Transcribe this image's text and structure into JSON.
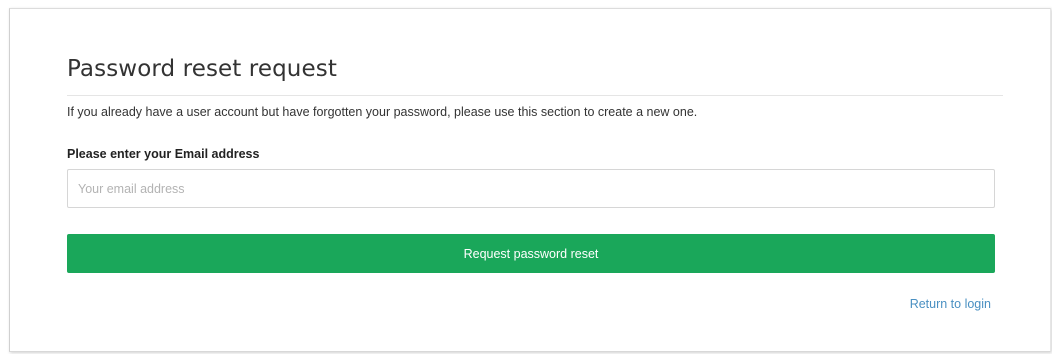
{
  "form": {
    "title": "Password reset request",
    "description": "If you already have a user account but have forgotten your password, please use this section to create a new one.",
    "email_label": "Please enter your Email address",
    "email_value": "",
    "email_placeholder": "Your email address",
    "submit_label": "Request password reset",
    "return_link_label": "Return to login"
  },
  "colors": {
    "accent_button": "#1aa75a",
    "link": "#4a90c2"
  }
}
